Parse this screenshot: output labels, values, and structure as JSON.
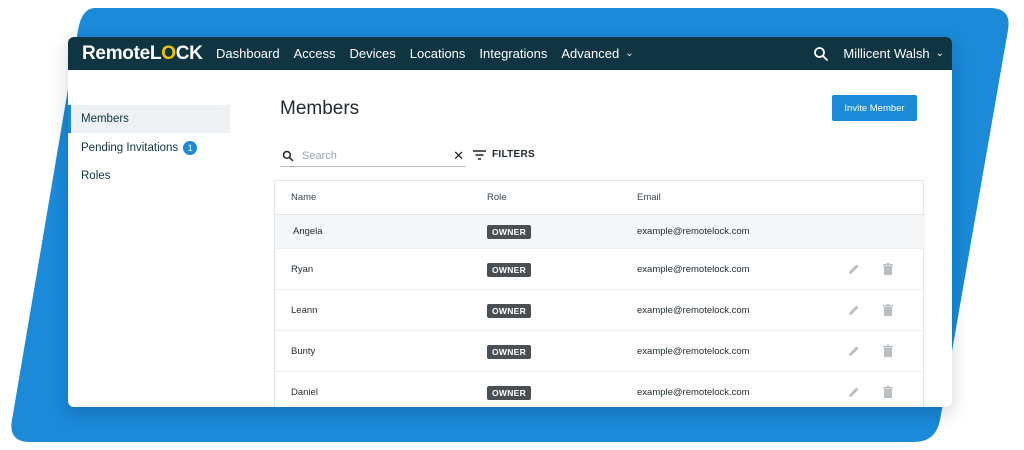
{
  "app": {
    "logo_part1": "Remote",
    "logo_part2": "L",
    "logo_part3": "O",
    "logo_part4": "CK"
  },
  "nav": {
    "items": [
      "Dashboard",
      "Access",
      "Devices",
      "Locations",
      "Integrations",
      "Advanced"
    ],
    "user_name": "Millicent Walsh"
  },
  "sidebar": {
    "items": [
      {
        "label": "Members",
        "active": true
      },
      {
        "label": "Pending Invitations",
        "badge": "1"
      },
      {
        "label": "Roles"
      }
    ]
  },
  "main": {
    "title": "Members",
    "invite_button": "Invite Member",
    "search_placeholder": "Search",
    "filters_label": "FILTERS"
  },
  "table": {
    "columns": [
      "Name",
      "Role",
      "Email"
    ],
    "rows": [
      {
        "name": "Angela",
        "role": "OWNER",
        "email": "example@remotelock.com",
        "actions": false
      },
      {
        "name": "Ryan",
        "role": "OWNER",
        "email": "example@remotelock.com",
        "actions": true
      },
      {
        "name": "Leann",
        "role": "OWNER",
        "email": "example@remotelock.com",
        "actions": true
      },
      {
        "name": "Bunty",
        "role": "OWNER",
        "email": "example@remotelock.com",
        "actions": true
      },
      {
        "name": "Daniel",
        "role": "OWNER",
        "email": "example@remotelock.com",
        "actions": true
      }
    ]
  },
  "colors": {
    "navbar": "#0f3542",
    "accent": "#1a8ad9",
    "backdrop": "#1a8ad9",
    "logo_highlight": "#f5c400"
  },
  "icons": {
    "search": "search-icon",
    "clear": "close-icon",
    "filters": "filter-icon",
    "edit": "pencil-icon",
    "delete": "trash-icon",
    "dropdown": "chevron-down-icon"
  }
}
